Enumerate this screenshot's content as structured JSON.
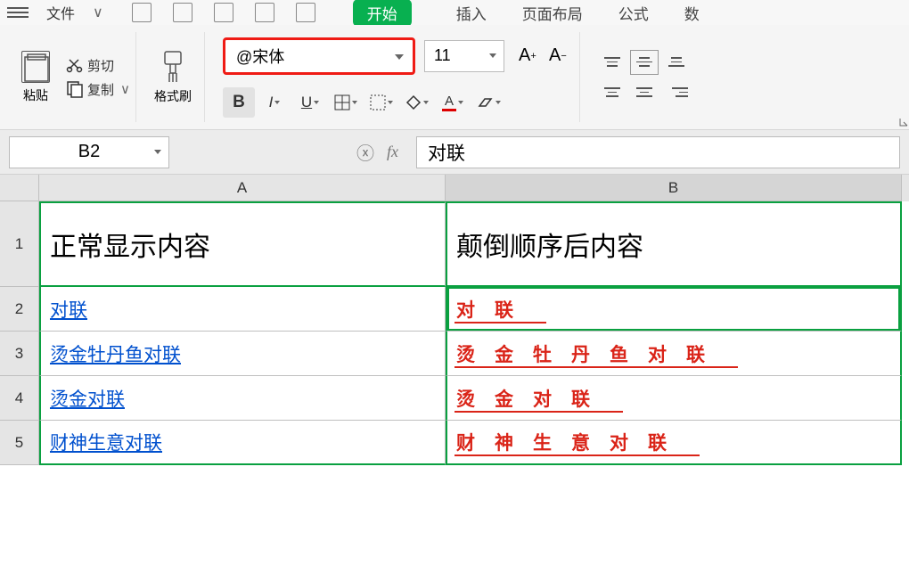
{
  "menubar": {
    "file_dropdown": "文件",
    "tabs": {
      "start": "开始",
      "insert": "插入",
      "layout": "页面布局",
      "formula": "公式",
      "data": "数"
    }
  },
  "ribbon": {
    "paste_label": "粘贴",
    "cut_label": "剪切",
    "copy_label": "复制",
    "format_painter": "格式刷",
    "font_name": "@宋体",
    "font_size": "11"
  },
  "namebox": {
    "cell_ref": "B2"
  },
  "formulabar": {
    "value": "对联"
  },
  "columns": {
    "a": "A",
    "b": "B"
  },
  "rows": {
    "r1": "1",
    "r2": "2",
    "r3": "3",
    "r4": "4",
    "r5": "5"
  },
  "headers": {
    "a": "正常显示内容",
    "b": "颠倒顺序后内容"
  },
  "chart_data": {
    "type": "table",
    "columns": [
      "正常显示内容",
      "颠倒顺序后内容"
    ],
    "rows": [
      {
        "a": "对联",
        "b": "对 联"
      },
      {
        "a": "烫金牡丹鱼对联",
        "b": "烫 金 牡 丹 鱼 对 联"
      },
      {
        "a": "烫金对联",
        "b": "烫 金 对 联"
      },
      {
        "a": "财神生意对联",
        "b": "财 神 生 意 对 联"
      }
    ]
  }
}
